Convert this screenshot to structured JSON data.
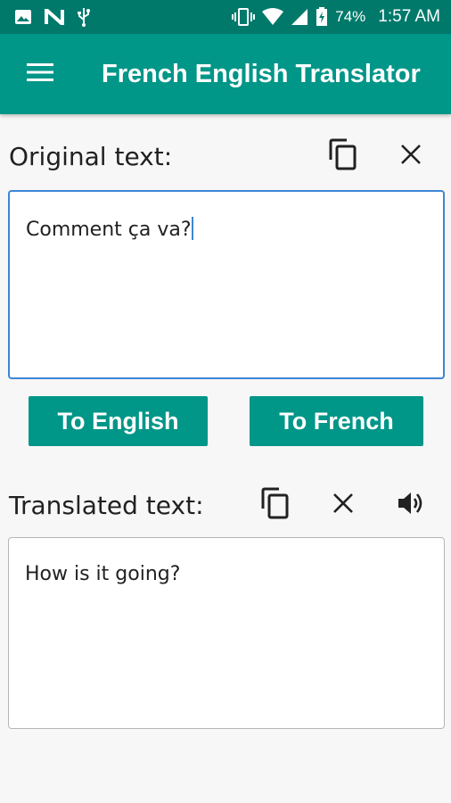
{
  "status_bar": {
    "battery": "74%",
    "time": "1:57 AM",
    "icons": [
      "image-icon",
      "n-icon",
      "usb-icon",
      "vibrate-icon",
      "wifi-icon",
      "signal-icon",
      "battery-charging-icon"
    ]
  },
  "app_bar": {
    "title": "French English Translator",
    "menu_icon": "menu-icon"
  },
  "original": {
    "label": "Original text:",
    "value": "Comment ça va?",
    "icons": [
      "copy-icon",
      "clear-icon"
    ]
  },
  "buttons": {
    "to_english": "To English",
    "to_french": "To French"
  },
  "translated": {
    "label": "Translated text:",
    "value": "How is it going?",
    "icons": [
      "copy-icon",
      "clear-icon",
      "speaker-icon"
    ]
  },
  "colors": {
    "status_bar": "#00796b",
    "primary": "#009688",
    "input_border": "#3d86d6",
    "background": "#f7f7f7"
  }
}
